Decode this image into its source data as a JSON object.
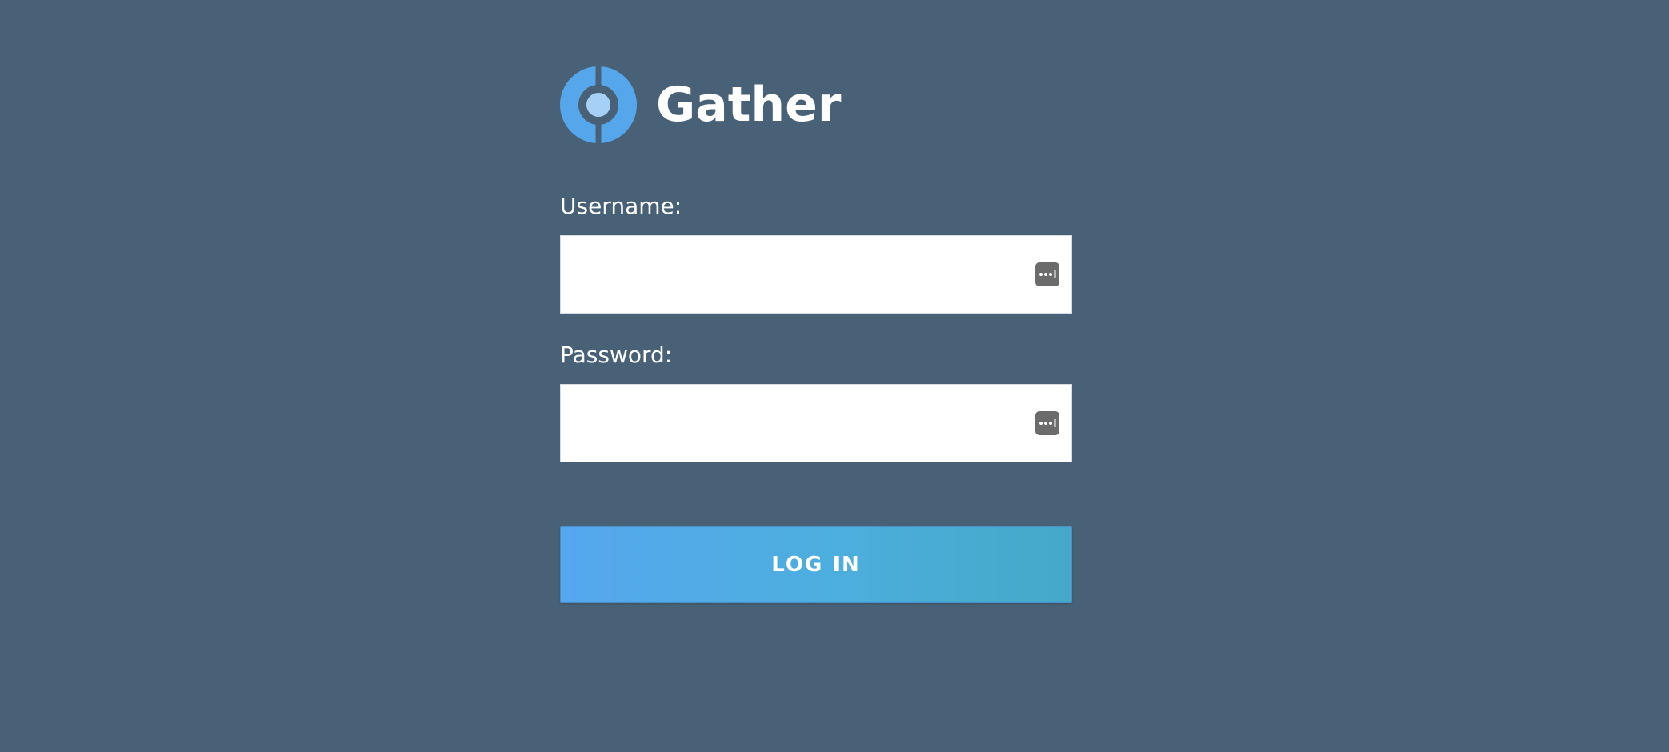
{
  "brand": {
    "name": "Gather",
    "logo_icon": "gather-logo-icon",
    "logo_colors": {
      "outer": "#56a6ec",
      "inner": "#a6d0f5"
    }
  },
  "form": {
    "username_label": "Username:",
    "username_value": "",
    "password_label": "Password:",
    "password_value": "",
    "field_icon": "password-manager-icon",
    "submit_label": "LOG IN"
  },
  "colors": {
    "background": "#486176",
    "button_gradient_start": "#55a7ee",
    "button_gradient_end": "#44a9c8"
  }
}
